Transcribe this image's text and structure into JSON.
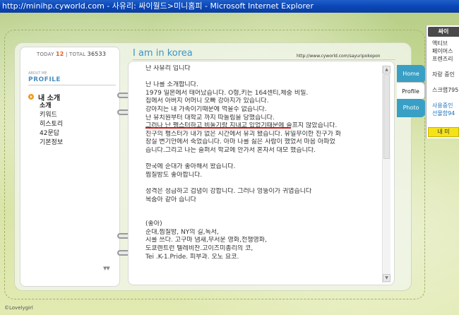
{
  "window": {
    "title": "http://minihp.cyworld.com - 사유리: 싸이월드>미니홈피 - Microsoft Internet Explorer"
  },
  "counter": {
    "today_label": "TODAY",
    "today_value": "12",
    "separator": "|",
    "total_label": "TOTAL",
    "total_value": "36533"
  },
  "sidebar": {
    "about_label": "ABOUT ME",
    "profile_title": "PROFILE",
    "main_item": "내 소개",
    "items": [
      {
        "label": "소개"
      },
      {
        "label": "키워드"
      },
      {
        "label": "히스토리"
      },
      {
        "label": "42문답"
      },
      {
        "label": "기본정보"
      }
    ]
  },
  "header": {
    "title": "I am in korea",
    "url": "http://www.cyworld.com/sayuripokopon"
  },
  "content": {
    "lines": [
      "난 사유리 입니다",
      "",
      "난 나를 소개합니다.",
      "1979 일본에서 태어났습니다. O형,키는 164센티,체중 비밀.",
      "집에서 아버지 어머니 오빠 강아지가 있습니다.",
      "강아지는 내 가족이기때문에 먹을수 없습니다.",
      "난 유치원부터 대학교 까지 따돌림을 당했습니다.",
      "그러나 난 펭스터하고 비둘기랑 지내고 있었기때문에 슬프지 않았습니다.",
      "친구의 펭스터가 내가 없은 시간에서 유괴 됐습니다. 유일무이한 친구가 화",
      "장실 변기안에서 죽었습니다. 아마 나를 싫은 사람이 했었서 마음 아파었",
      "습니다.그리고 나는 슬퍼서 학교에 안가서 혼자서 대모 했습니다.",
      "",
      "한국에 순대가 좋아해서 왔습니다.",
      "찜질방도 좋아합니다.",
      "",
      "성격은 성급하고 겁념이 강합니다. 그러나 엉뚱이가 귀엽습니다",
      "목숨아 같아 습니다",
      "",
      "",
      " (좋아)",
      "순대,찜질방, NY의 길,독서,",
      "시를 쓰다. 고구마 냄새,무서운 영화,전쟁영화,",
      "도쿄렌트런 텔레비잔.고이즈미총리의 코,",
      "Tei .K-1.Pride. 피부과. 오노 요코."
    ]
  },
  "tabs": [
    {
      "label": "Home"
    },
    {
      "label": "Profile"
    },
    {
      "label": "Photo"
    }
  ],
  "side_panel": {
    "header": "싸이",
    "items": [
      {
        "label": "액티브"
      },
      {
        "label": "페이머스"
      },
      {
        "label": "프렌즈리"
      },
      {
        "label": ""
      },
      {
        "label": "자랑 중인"
      },
      {
        "label": ""
      },
      {
        "label": "스크랩795"
      },
      {
        "label": ""
      },
      {
        "label": "사용중인"
      },
      {
        "label": "선물함94"
      }
    ],
    "yellow_button": "내 미"
  },
  "footer": {
    "copyright": "©Lovelygirl"
  }
}
